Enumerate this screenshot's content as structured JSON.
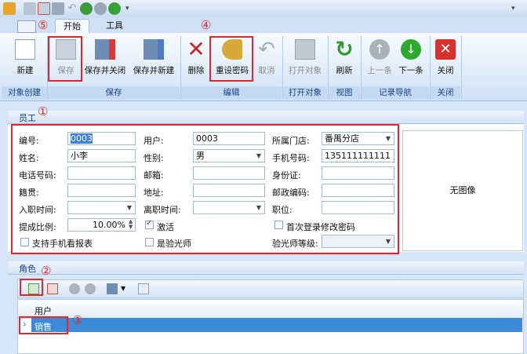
{
  "tabs": {
    "marker": "⑤",
    "start": "开始",
    "tools": "工具"
  },
  "ribbon": {
    "new": "新建",
    "save": "保存",
    "save_close": "保存并关闭",
    "save_new": "保存并新建",
    "delete": "删除",
    "reset_pwd": "重设密码",
    "cancel": "取消",
    "open_obj": "打开对象",
    "refresh": "刷新",
    "prev": "上一条",
    "next": "下一条",
    "close": "关闭",
    "groups": {
      "create": "对象创建",
      "save": "保存",
      "edit": "编辑",
      "open": "打开对象",
      "view": "视图",
      "nav": "记录导航",
      "close": "关闭"
    },
    "marker4": "④"
  },
  "employee": {
    "title": "员工",
    "marker": "①",
    "labels": {
      "code": "编号:",
      "user": "用户:",
      "store": "所属门店:",
      "name": "姓名:",
      "gender": "性别:",
      "mobile": "手机号码:",
      "phone": "电话号码:",
      "email": "邮箱:",
      "idcard": "身份证:",
      "native": "籍贯:",
      "address": "地址:",
      "zip": "邮政编码:",
      "hire": "入职时间:",
      "leave": "离职时间:",
      "position": "职位:",
      "commission": "提成比例:",
      "active": "激活",
      "first_login": "首次登录修改密码",
      "mobile_report": "支持手机看报表",
      "inspector": "是验光师",
      "inspector_level": "验光师等级:"
    },
    "values": {
      "code": "0003",
      "user": "0003",
      "store": "番禺分店",
      "name": "小李",
      "gender": "男",
      "mobile": "135111111111",
      "commission": "10.00%"
    },
    "no_photo": "无图像"
  },
  "role": {
    "title": "角色",
    "marker2": "②",
    "marker3": "③",
    "col_user": "用户",
    "row1": "销售"
  }
}
